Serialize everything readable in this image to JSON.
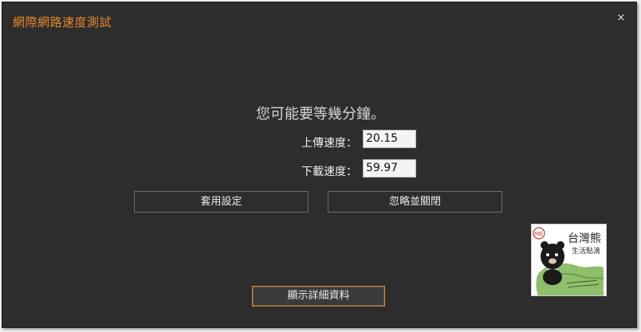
{
  "window": {
    "title": "網際網路速度測試",
    "close_glyph": "×"
  },
  "main": {
    "message": "您可能要等幾分鐘。",
    "upload_label": "上傳速度：",
    "upload_value": "20.15",
    "download_label": "下載速度：",
    "download_value": "59.97"
  },
  "buttons": {
    "apply": "套用設定",
    "ignore_close": "忽略並關閉",
    "show_details": "顯示詳細資料"
  },
  "watermark": {
    "badge": "ME",
    "brand": "台灣熊",
    "sub": "生活點滴"
  },
  "colors": {
    "accent": "#e8892a",
    "background": "#2d2d2d"
  }
}
